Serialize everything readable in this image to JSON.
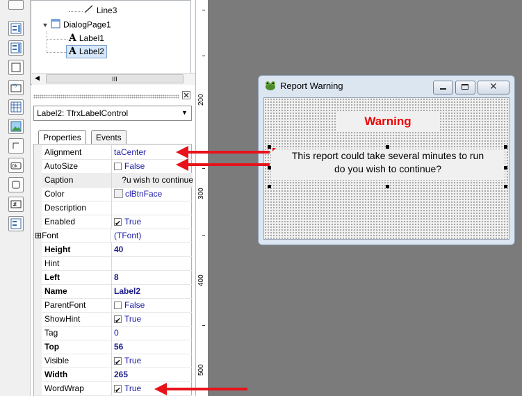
{
  "tree": {
    "nodes": [
      {
        "label": "Line3",
        "icon": "line-icon"
      },
      {
        "label": "DialogPage1",
        "icon": "dialog-page-icon"
      },
      {
        "label": "Label1",
        "icon": "label-a-icon"
      },
      {
        "label": "Label2",
        "icon": "label-a-icon",
        "selected": true
      }
    ],
    "hscroll_thumb": "III"
  },
  "object_selector": {
    "value": "Label2: TfrxLabelControl"
  },
  "tabs": [
    {
      "label": "Properties"
    },
    {
      "label": "Events"
    }
  ],
  "properties": [
    {
      "name": "Alignment",
      "value": "taCenter"
    },
    {
      "name": "AutoSize",
      "value": "False",
      "checkbox": false
    },
    {
      "name": "Caption",
      "value": "u wish to continue?",
      "highlight": true
    },
    {
      "name": "Color",
      "value": "clBtnFace",
      "swatch": true
    },
    {
      "name": "Description",
      "value": ""
    },
    {
      "name": "Enabled",
      "value": "True",
      "checkbox": true
    },
    {
      "name": "Font",
      "value": "(TFont)",
      "expandable": true,
      "expander": "⊞"
    },
    {
      "name": "Height",
      "value": "40",
      "bold": true
    },
    {
      "name": "Hint",
      "value": ""
    },
    {
      "name": "Left",
      "value": "8",
      "bold": true
    },
    {
      "name": "Name",
      "value": "Label2",
      "bold": true
    },
    {
      "name": "ParentFont",
      "value": "False",
      "checkbox": false
    },
    {
      "name": "ShowHint",
      "value": "True",
      "checkbox": true
    },
    {
      "name": "Tag",
      "value": "0"
    },
    {
      "name": "Top",
      "value": "56",
      "bold": true
    },
    {
      "name": "Visible",
      "value": "True",
      "checkbox": true
    },
    {
      "name": "Width",
      "value": "265",
      "bold": true
    },
    {
      "name": "WordWrap",
      "value": "True",
      "checkbox": true
    }
  ],
  "ruler": {
    "labels": [
      "200",
      "300",
      "400",
      "500"
    ]
  },
  "dialog": {
    "title": "Report Warning",
    "heading": "Warning",
    "message_line1": "This report could take several minutes to run",
    "message_line2": "do you wish to continue?",
    "heading_color": "#ee0000"
  },
  "annotations": {
    "arrow_color": "#e8121a"
  }
}
